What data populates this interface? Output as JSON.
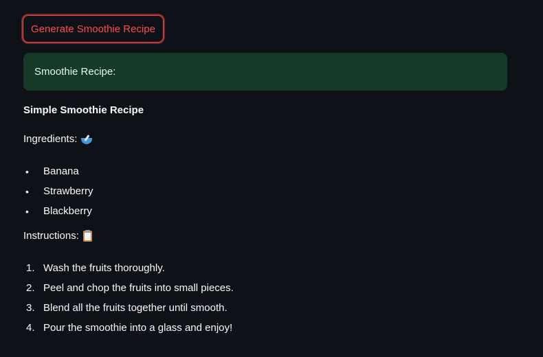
{
  "button": {
    "label": "Generate Smoothie Recipe"
  },
  "success": {
    "text": "Smoothie Recipe:"
  },
  "recipe": {
    "title": "Simple Smoothie Recipe",
    "ingredients_label": "Ingredients:",
    "ingredients_icon": "bowl-with-spoon-icon",
    "ingredients": [
      "Banana",
      "Strawberry",
      "Blackberry"
    ],
    "instructions_label": "Instructions:",
    "instructions_icon": "clipboard-icon",
    "instructions": [
      "Wash the fruits thoroughly.",
      "Peel and chop the fruits into small pieces.",
      "Blend all the fruits together until smooth.",
      "Pour the smoothie into a glass and enjoy!"
    ]
  },
  "colors": {
    "background": "#0e1117",
    "accent": "#ff4b4b",
    "success_bg": "#173928",
    "success_text": "#dffde9"
  }
}
